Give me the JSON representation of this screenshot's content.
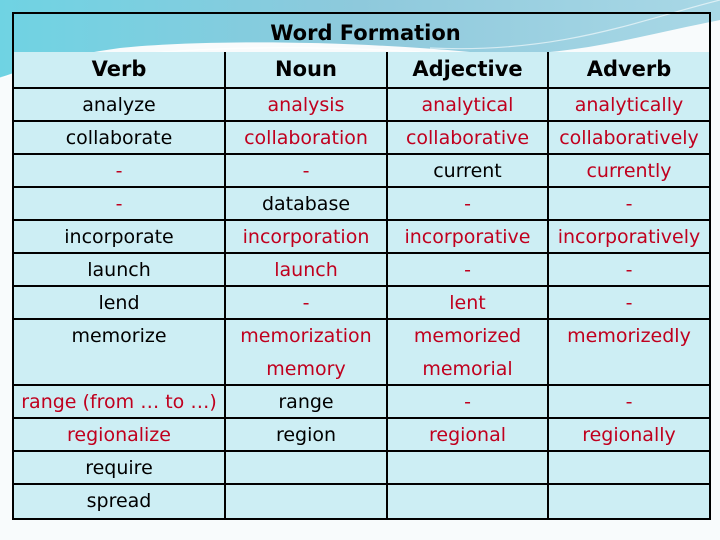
{
  "title": "Word Formation",
  "colors": {
    "derived_text": "#c0001e",
    "base_text": "#000000",
    "cell_background": "#cdeef4",
    "border": "#000000"
  },
  "columns": [
    "Verb",
    "Noun",
    "Adjective",
    "Adverb"
  ],
  "rows": [
    {
      "verb": [
        {
          "t": "analyze",
          "red": false
        }
      ],
      "noun": [
        {
          "t": "analysis",
          "red": true
        }
      ],
      "adjective": [
        {
          "t": "analytical",
          "red": true
        }
      ],
      "adverb": [
        {
          "t": "analytically",
          "red": true
        }
      ]
    },
    {
      "verb": [
        {
          "t": "collaborate",
          "red": false
        }
      ],
      "noun": [
        {
          "t": "collaboration",
          "red": true
        }
      ],
      "adjective": [
        {
          "t": "collaborative",
          "red": true
        }
      ],
      "adverb": [
        {
          "t": "collaboratively",
          "red": true
        }
      ]
    },
    {
      "verb": [
        {
          "t": "-",
          "red": true
        }
      ],
      "noun": [
        {
          "t": "-",
          "red": true
        }
      ],
      "adjective": [
        {
          "t": "current",
          "red": false
        }
      ],
      "adverb": [
        {
          "t": "currently",
          "red": true
        }
      ]
    },
    {
      "verb": [
        {
          "t": "-",
          "red": true
        }
      ],
      "noun": [
        {
          "t": "database",
          "red": false
        }
      ],
      "adjective": [
        {
          "t": "-",
          "red": true
        }
      ],
      "adverb": [
        {
          "t": "-",
          "red": true
        }
      ]
    },
    {
      "verb": [
        {
          "t": "incorporate",
          "red": false
        }
      ],
      "noun": [
        {
          "t": "incorporation",
          "red": true
        }
      ],
      "adjective": [
        {
          "t": "incorporative",
          "red": true
        }
      ],
      "adverb": [
        {
          "t": "incorporatively",
          "red": true
        }
      ]
    },
    {
      "verb": [
        {
          "t": "launch",
          "red": false
        }
      ],
      "noun": [
        {
          "t": "launch",
          "red": true
        }
      ],
      "adjective": [
        {
          "t": "-",
          "red": true
        }
      ],
      "adverb": [
        {
          "t": "-",
          "red": true
        }
      ]
    },
    {
      "verb": [
        {
          "t": "lend",
          "red": false
        }
      ],
      "noun": [
        {
          "t": "-",
          "red": true
        }
      ],
      "adjective": [
        {
          "t": "lent",
          "red": true
        }
      ],
      "adverb": [
        {
          "t": "-",
          "red": true
        }
      ]
    },
    {
      "verb": [
        {
          "t": "memorize",
          "red": false
        }
      ],
      "noun": [
        {
          "t": "memorization",
          "red": true
        },
        {
          "t": "memory",
          "red": true
        }
      ],
      "adjective": [
        {
          "t": "memorized",
          "red": true
        },
        {
          "t": "memorial",
          "red": true
        }
      ],
      "adverb": [
        {
          "t": "memorizedly",
          "red": true
        }
      ]
    },
    {
      "verb": [
        {
          "t": "range (from … to …)",
          "red": true
        }
      ],
      "noun": [
        {
          "t": "range",
          "red": false
        }
      ],
      "adjective": [
        {
          "t": "-",
          "red": true
        }
      ],
      "adverb": [
        {
          "t": "-",
          "red": true
        }
      ]
    },
    {
      "verb": [
        {
          "t": "regionalize",
          "red": true
        }
      ],
      "noun": [
        {
          "t": "region",
          "red": false
        }
      ],
      "adjective": [
        {
          "t": "regional",
          "red": true
        }
      ],
      "adverb": [
        {
          "t": "regionally",
          "red": true
        }
      ]
    },
    {
      "verb": [
        {
          "t": "require",
          "red": false
        }
      ],
      "noun": [],
      "adjective": [],
      "adverb": []
    },
    {
      "verb": [
        {
          "t": "spread",
          "red": false
        }
      ],
      "noun": [],
      "adjective": [],
      "adverb": []
    }
  ]
}
